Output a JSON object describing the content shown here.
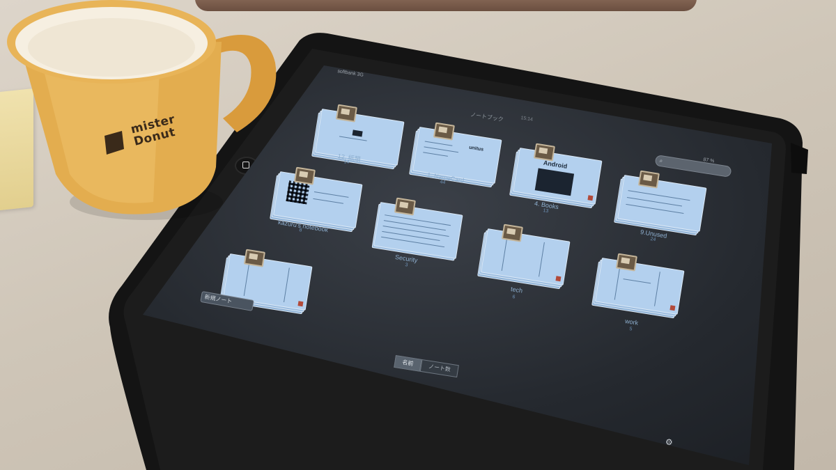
{
  "mug": {
    "logo_text": "mister\nDonut",
    "color": "#e3ad4f"
  },
  "app": {
    "status_left": "softbank 3G",
    "status_right": "87 %",
    "nav_title": "ノートブック",
    "nav_time": "15:14",
    "search_icon": "search-icon",
    "new_note_label": "新規ノート",
    "sort_options": [
      "名前",
      "ノート数"
    ],
    "sort_selected": "名前",
    "settings_icon": "gear-icon"
  },
  "notebooks": [
    {
      "name": "12. 紙類",
      "count": "14"
    },
    {
      "name": "1. NameCard",
      "count": "44"
    },
    {
      "name": "4. Books",
      "count": "13"
    },
    {
      "name": "9.Unused",
      "count": "24"
    },
    {
      "name": "kazuru's notebook",
      "count": "8"
    },
    {
      "name": "Security",
      "count": "3"
    },
    {
      "name": "tech",
      "count": "6"
    },
    {
      "name": "work",
      "count": "5"
    },
    {
      "name": "",
      "count": ""
    }
  ],
  "card_texts": {
    "books_title": "Android",
    "namecard_word": "unitus"
  },
  "colors": {
    "screen": "#25292f",
    "sheet": "#b3d0ee",
    "case": "#141414",
    "table": "#cfc6b8"
  }
}
